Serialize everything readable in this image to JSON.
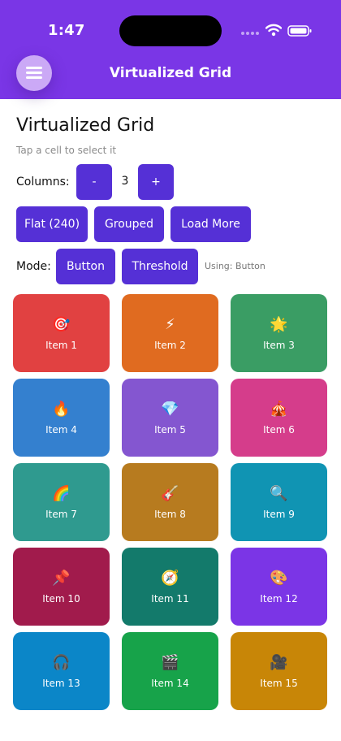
{
  "status_bar": {
    "time": "1:47"
  },
  "header": {
    "title": "Virtualized Grid"
  },
  "page": {
    "title": "Virtualized Grid",
    "hint": "Tap a cell to select it"
  },
  "columns": {
    "label": "Columns:",
    "decrement": "-",
    "value": "3",
    "increment": "+"
  },
  "dataset_buttons": {
    "flat": "Flat (240)",
    "grouped": "Grouped",
    "load_more": "Load More"
  },
  "mode": {
    "label": "Mode:",
    "button": "Button",
    "threshold": "Threshold",
    "status": "Using: Button"
  },
  "colors": {
    "header": "#7a36e6",
    "button": "#5530d6"
  },
  "grid": {
    "items": [
      {
        "label": "Item 1",
        "icon": "🎯",
        "icon_name": "dart-target-icon",
        "color": "#e14141"
      },
      {
        "label": "Item 2",
        "icon": "⚡",
        "icon_name": "lightning-icon",
        "color": "#e06b20"
      },
      {
        "label": "Item 3",
        "icon": "🌟",
        "icon_name": "star-icon",
        "color": "#3a9d64"
      },
      {
        "label": "Item 4",
        "icon": "🔥",
        "icon_name": "fire-icon",
        "color": "#3480cf"
      },
      {
        "label": "Item 5",
        "icon": "💎",
        "icon_name": "gem-icon",
        "color": "#8456d0"
      },
      {
        "label": "Item 6",
        "icon": "🎪",
        "icon_name": "circus-tent-icon",
        "color": "#d53d8b"
      },
      {
        "label": "Item 7",
        "icon": "🌈",
        "icon_name": "rainbow-icon",
        "color": "#2f9a8f"
      },
      {
        "label": "Item 8",
        "icon": "🎸",
        "icon_name": "guitar-icon",
        "color": "#b77b1f"
      },
      {
        "label": "Item 9",
        "icon": "🔍",
        "icon_name": "magnifier-icon",
        "color": "#1094b3"
      },
      {
        "label": "Item 10",
        "icon": "📌",
        "icon_name": "pushpin-icon",
        "color": "#a11b4c"
      },
      {
        "label": "Item 11",
        "icon": "🧭",
        "icon_name": "compass-icon",
        "color": "#137a6b"
      },
      {
        "label": "Item 12",
        "icon": "🎨",
        "icon_name": "palette-icon",
        "color": "#7b35e6"
      },
      {
        "label": "Item 13",
        "icon": "🎧",
        "icon_name": "headphones-icon",
        "color": "#0b86c8"
      },
      {
        "label": "Item 14",
        "icon": "🎬",
        "icon_name": "clapperboard-icon",
        "color": "#17a34a"
      },
      {
        "label": "Item 15",
        "icon": "🎥",
        "icon_name": "movie-camera-icon",
        "color": "#c88607"
      }
    ]
  }
}
